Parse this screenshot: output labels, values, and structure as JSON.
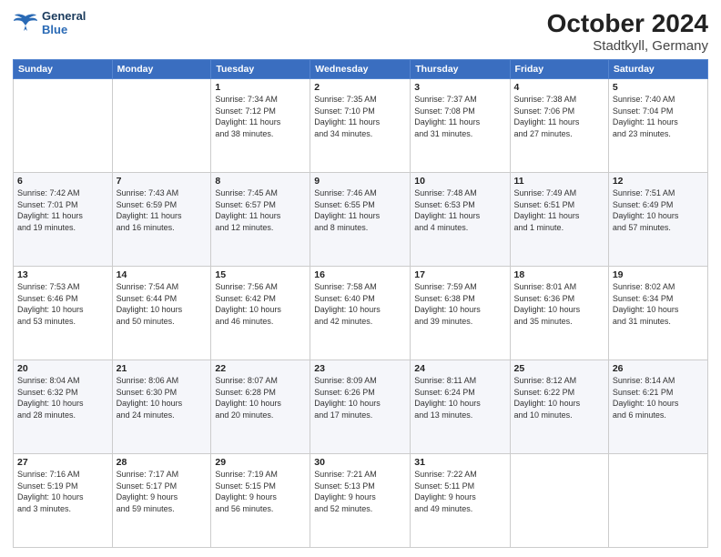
{
  "header": {
    "logo_line1": "General",
    "logo_line2": "Blue",
    "month": "October 2024",
    "location": "Stadtkyll, Germany"
  },
  "weekdays": [
    "Sunday",
    "Monday",
    "Tuesday",
    "Wednesday",
    "Thursday",
    "Friday",
    "Saturday"
  ],
  "weeks": [
    [
      {
        "day": "",
        "info": ""
      },
      {
        "day": "",
        "info": ""
      },
      {
        "day": "1",
        "info": "Sunrise: 7:34 AM\nSunset: 7:12 PM\nDaylight: 11 hours\nand 38 minutes."
      },
      {
        "day": "2",
        "info": "Sunrise: 7:35 AM\nSunset: 7:10 PM\nDaylight: 11 hours\nand 34 minutes."
      },
      {
        "day": "3",
        "info": "Sunrise: 7:37 AM\nSunset: 7:08 PM\nDaylight: 11 hours\nand 31 minutes."
      },
      {
        "day": "4",
        "info": "Sunrise: 7:38 AM\nSunset: 7:06 PM\nDaylight: 11 hours\nand 27 minutes."
      },
      {
        "day": "5",
        "info": "Sunrise: 7:40 AM\nSunset: 7:04 PM\nDaylight: 11 hours\nand 23 minutes."
      }
    ],
    [
      {
        "day": "6",
        "info": "Sunrise: 7:42 AM\nSunset: 7:01 PM\nDaylight: 11 hours\nand 19 minutes."
      },
      {
        "day": "7",
        "info": "Sunrise: 7:43 AM\nSunset: 6:59 PM\nDaylight: 11 hours\nand 16 minutes."
      },
      {
        "day": "8",
        "info": "Sunrise: 7:45 AM\nSunset: 6:57 PM\nDaylight: 11 hours\nand 12 minutes."
      },
      {
        "day": "9",
        "info": "Sunrise: 7:46 AM\nSunset: 6:55 PM\nDaylight: 11 hours\nand 8 minutes."
      },
      {
        "day": "10",
        "info": "Sunrise: 7:48 AM\nSunset: 6:53 PM\nDaylight: 11 hours\nand 4 minutes."
      },
      {
        "day": "11",
        "info": "Sunrise: 7:49 AM\nSunset: 6:51 PM\nDaylight: 11 hours\nand 1 minute."
      },
      {
        "day": "12",
        "info": "Sunrise: 7:51 AM\nSunset: 6:49 PM\nDaylight: 10 hours\nand 57 minutes."
      }
    ],
    [
      {
        "day": "13",
        "info": "Sunrise: 7:53 AM\nSunset: 6:46 PM\nDaylight: 10 hours\nand 53 minutes."
      },
      {
        "day": "14",
        "info": "Sunrise: 7:54 AM\nSunset: 6:44 PM\nDaylight: 10 hours\nand 50 minutes."
      },
      {
        "day": "15",
        "info": "Sunrise: 7:56 AM\nSunset: 6:42 PM\nDaylight: 10 hours\nand 46 minutes."
      },
      {
        "day": "16",
        "info": "Sunrise: 7:58 AM\nSunset: 6:40 PM\nDaylight: 10 hours\nand 42 minutes."
      },
      {
        "day": "17",
        "info": "Sunrise: 7:59 AM\nSunset: 6:38 PM\nDaylight: 10 hours\nand 39 minutes."
      },
      {
        "day": "18",
        "info": "Sunrise: 8:01 AM\nSunset: 6:36 PM\nDaylight: 10 hours\nand 35 minutes."
      },
      {
        "day": "19",
        "info": "Sunrise: 8:02 AM\nSunset: 6:34 PM\nDaylight: 10 hours\nand 31 minutes."
      }
    ],
    [
      {
        "day": "20",
        "info": "Sunrise: 8:04 AM\nSunset: 6:32 PM\nDaylight: 10 hours\nand 28 minutes."
      },
      {
        "day": "21",
        "info": "Sunrise: 8:06 AM\nSunset: 6:30 PM\nDaylight: 10 hours\nand 24 minutes."
      },
      {
        "day": "22",
        "info": "Sunrise: 8:07 AM\nSunset: 6:28 PM\nDaylight: 10 hours\nand 20 minutes."
      },
      {
        "day": "23",
        "info": "Sunrise: 8:09 AM\nSunset: 6:26 PM\nDaylight: 10 hours\nand 17 minutes."
      },
      {
        "day": "24",
        "info": "Sunrise: 8:11 AM\nSunset: 6:24 PM\nDaylight: 10 hours\nand 13 minutes."
      },
      {
        "day": "25",
        "info": "Sunrise: 8:12 AM\nSunset: 6:22 PM\nDaylight: 10 hours\nand 10 minutes."
      },
      {
        "day": "26",
        "info": "Sunrise: 8:14 AM\nSunset: 6:21 PM\nDaylight: 10 hours\nand 6 minutes."
      }
    ],
    [
      {
        "day": "27",
        "info": "Sunrise: 7:16 AM\nSunset: 5:19 PM\nDaylight: 10 hours\nand 3 minutes."
      },
      {
        "day": "28",
        "info": "Sunrise: 7:17 AM\nSunset: 5:17 PM\nDaylight: 9 hours\nand 59 minutes."
      },
      {
        "day": "29",
        "info": "Sunrise: 7:19 AM\nSunset: 5:15 PM\nDaylight: 9 hours\nand 56 minutes."
      },
      {
        "day": "30",
        "info": "Sunrise: 7:21 AM\nSunset: 5:13 PM\nDaylight: 9 hours\nand 52 minutes."
      },
      {
        "day": "31",
        "info": "Sunrise: 7:22 AM\nSunset: 5:11 PM\nDaylight: 9 hours\nand 49 minutes."
      },
      {
        "day": "",
        "info": ""
      },
      {
        "day": "",
        "info": ""
      }
    ]
  ]
}
